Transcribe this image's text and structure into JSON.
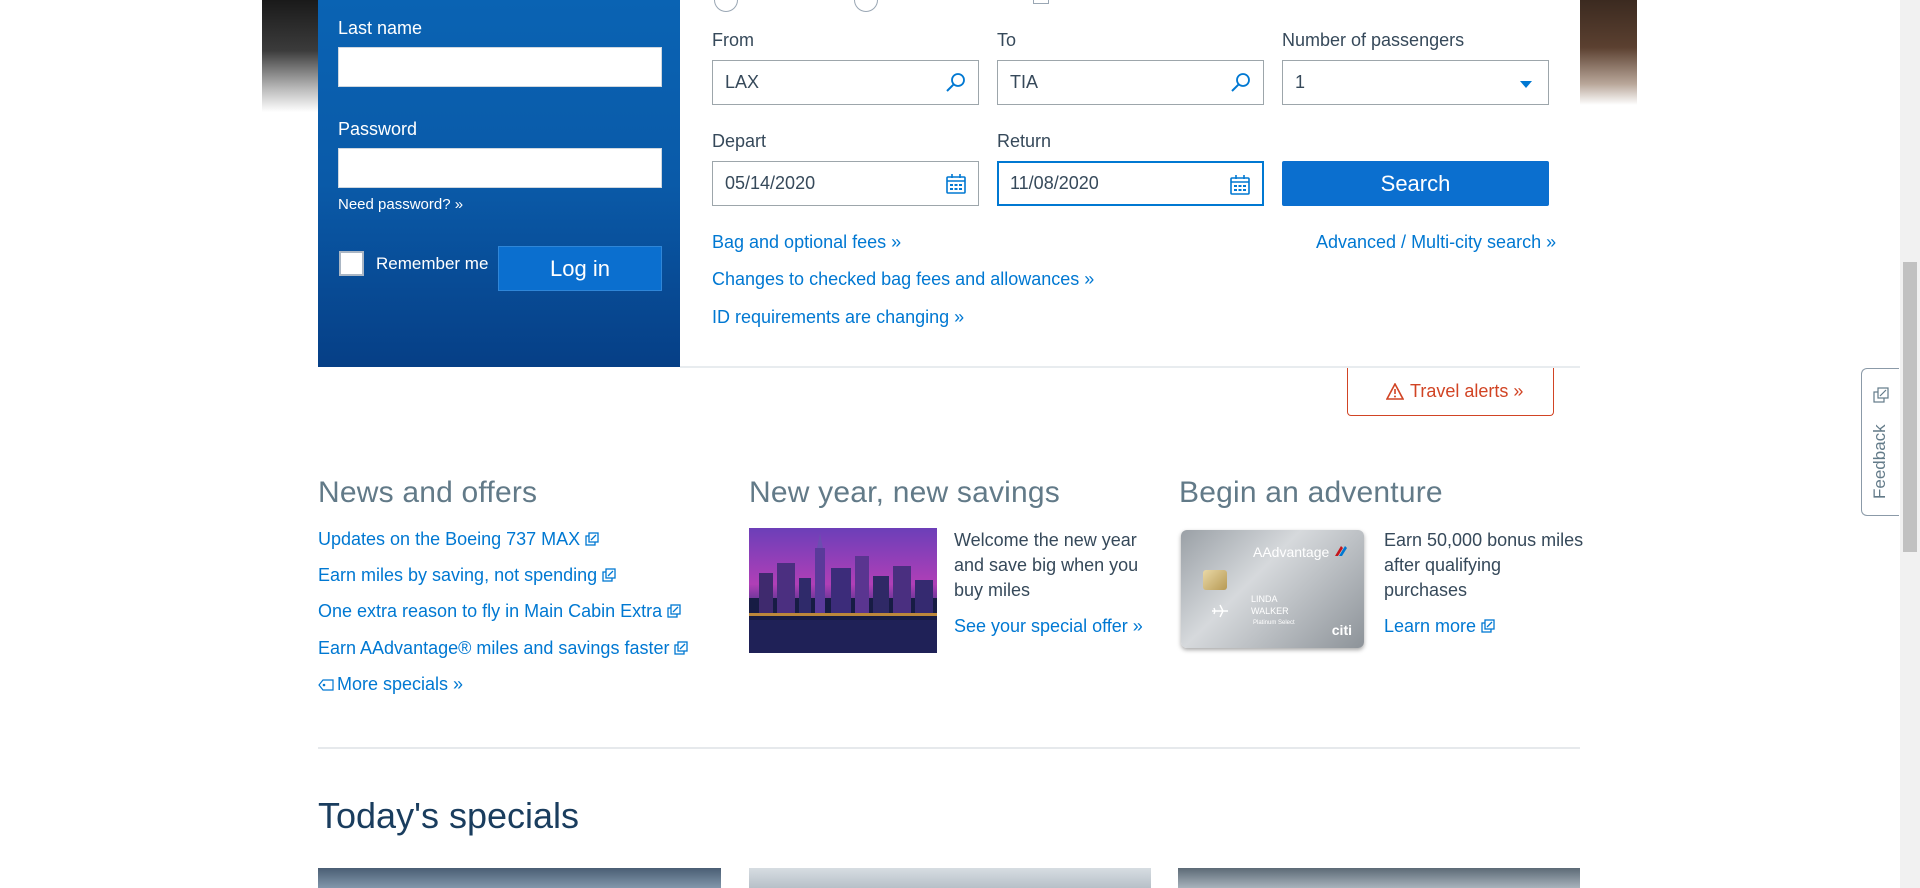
{
  "login": {
    "last_name_label": "Last name",
    "password_label": "Password",
    "need_password": "Need password? »",
    "remember_me": "Remember me",
    "login_button": "Log in"
  },
  "booking": {
    "from_label": "From",
    "from_value": "LAX",
    "to_label": "To",
    "to_value": "TIA",
    "passengers_label": "Number of passengers",
    "passengers_value": "1",
    "depart_label": "Depart",
    "depart_value": "05/14/2020",
    "return_label": "Return",
    "return_value": "11/08/2020",
    "search_button": "Search",
    "links": {
      "bag_fees": "Bag and optional fees »",
      "advanced": "Advanced / Multi-city search »",
      "changes": "Changes to checked bag fees and allowances »",
      "id_requirements": "ID requirements are changing »"
    }
  },
  "travel_alerts": "Travel alerts »",
  "news": {
    "title": "News and offers",
    "items": [
      "Updates on the Boeing 737 MAX",
      "Earn miles by saving, not spending",
      "One extra reason to fly in Main Cabin Extra",
      "Earn AAdvantage® miles and savings faster"
    ],
    "more": "More specials »"
  },
  "savings": {
    "title": "New year, new savings",
    "text_lines": [
      "Welcome the new year",
      "and save big when you",
      "buy miles"
    ],
    "link": "See your special offer »"
  },
  "adventure": {
    "title": "Begin an adventure",
    "text_lines": [
      "Earn 50,000 bonus miles",
      "after qualifying",
      "purchases"
    ],
    "link": "Learn more",
    "card_brand": "AAdvantage",
    "card_name_1": "LINDA",
    "card_name_2": "WALKER",
    "card_tier": "Platinum Select",
    "card_bank": "citi"
  },
  "todays_specials": "Today's specials",
  "feedback": "Feedback",
  "colors": {
    "primary_blue": "#0078d2",
    "alert_red": "#d14424",
    "login_panel": "#0a5aa8"
  }
}
